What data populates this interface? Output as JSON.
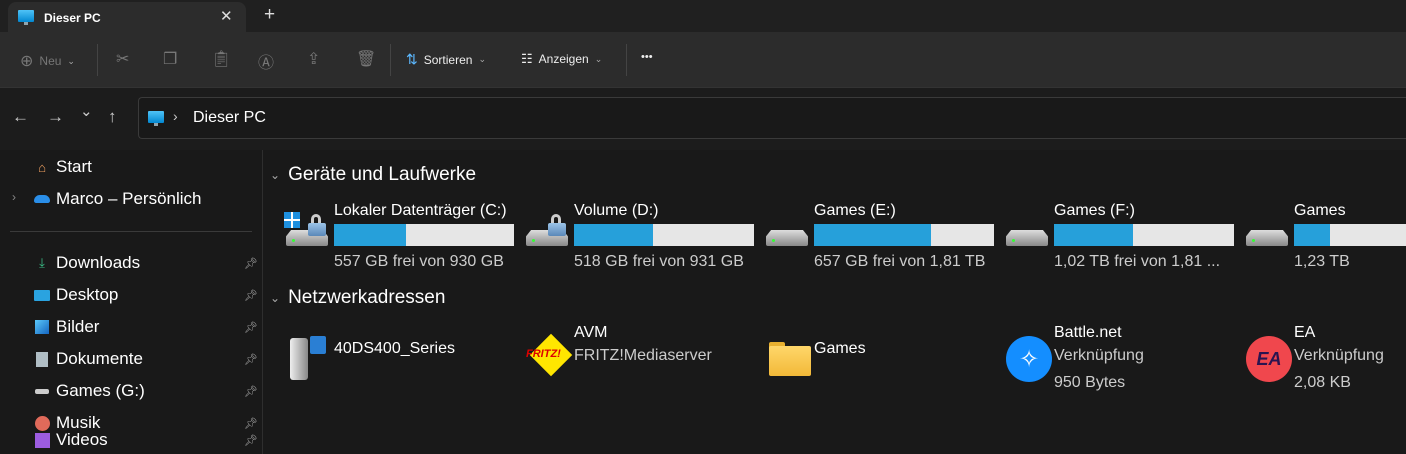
{
  "tab": {
    "title": "Dieser PC",
    "close": "✕",
    "new": "+"
  },
  "toolbar": {
    "new_label": "Neu",
    "sort_label": "Sortieren",
    "view_label": "Anzeigen",
    "more": "•••"
  },
  "address": {
    "path": "Dieser PC",
    "separator": "›"
  },
  "nav": {
    "back": "←",
    "forward": "→",
    "recent": "⌄",
    "up": "↑"
  },
  "sidebar": {
    "top": [
      {
        "label": "Start",
        "icon": "home-icon"
      },
      {
        "label": "Marco – Persönlich",
        "icon": "onedrive-icon"
      }
    ],
    "pinned": [
      {
        "label": "Downloads",
        "icon": "download-icon"
      },
      {
        "label": "Desktop",
        "icon": "desktop-icon"
      },
      {
        "label": "Bilder",
        "icon": "pictures-icon"
      },
      {
        "label": "Dokumente",
        "icon": "documents-icon"
      },
      {
        "label": "Games (G:)",
        "icon": "drive-icon"
      },
      {
        "label": "Musik",
        "icon": "music-icon"
      },
      {
        "label": "Videos",
        "icon": "videos-icon"
      }
    ]
  },
  "sections": {
    "drives": "Geräte und Laufwerke",
    "network": "Netzwerkadressen"
  },
  "drives": [
    {
      "name": "Lokaler Datenträger (C:)",
      "free": "557 GB frei von 930 GB",
      "used_fraction": 0.4
    },
    {
      "name": "Volume (D:)",
      "free": "518 GB frei von 931 GB",
      "used_fraction": 0.44
    },
    {
      "name": "Games (E:)",
      "free": "657 GB frei von 1,81 TB",
      "used_fraction": 0.65
    },
    {
      "name": "Games (F:)",
      "free": "1,02 TB frei von 1,81 ...",
      "used_fraction": 0.44
    },
    {
      "name": "Games",
      "free": "1,23 TB",
      "used_fraction": 0.32
    }
  ],
  "network": [
    {
      "name": "40DS400_Series"
    },
    {
      "name": "AVM",
      "sub": "FRITZ!Mediaserver"
    },
    {
      "name": "Games"
    },
    {
      "name": "Battle.net",
      "sub": "Verknüpfung",
      "size": "950 Bytes"
    },
    {
      "name": "EA",
      "sub": "Verknüpfung",
      "size": "2,08 KB"
    }
  ],
  "colors": {
    "accent": "#26a0da",
    "bar_bg": "#e6e6e6",
    "ea": "#f0474d",
    "battlenet": "#148eff"
  }
}
